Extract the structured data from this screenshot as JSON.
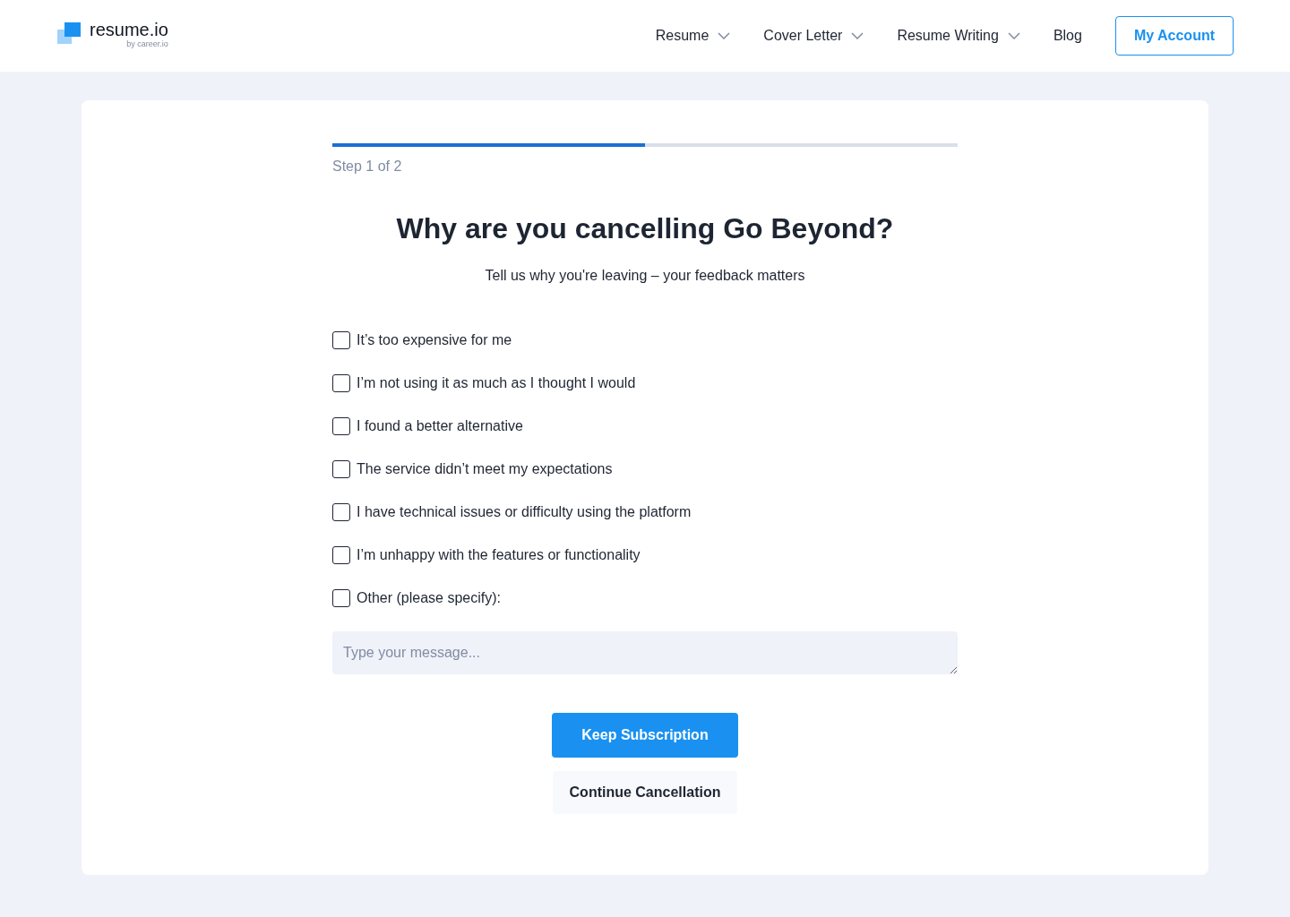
{
  "logo": {
    "name": "resume.io",
    "byline": "by career.io"
  },
  "nav": [
    {
      "label": "Resume",
      "dropdown": true
    },
    {
      "label": "Cover Letter",
      "dropdown": true
    },
    {
      "label": "Resume Writing",
      "dropdown": true
    },
    {
      "label": "Blog",
      "dropdown": false
    }
  ],
  "account_button": "My Account",
  "progress": {
    "level": 0.5,
    "step_label": "Step 1 of 2"
  },
  "title": "Why are you cancelling Go Beyond?",
  "subtitle": "Tell us why you're leaving – your feedback matters",
  "reasons": [
    {
      "label": "It’s too expensive for me",
      "checked": false
    },
    {
      "label": "I’m not using it as much as I thought I would",
      "checked": false
    },
    {
      "label": "I found a better alternative",
      "checked": false
    },
    {
      "label": "The service didn’t meet my expectations",
      "checked": false
    },
    {
      "label": "I have technical issues or difficulty using the platform",
      "checked": false
    },
    {
      "label": "I’m unhappy with the features or functionality",
      "checked": false
    },
    {
      "label": "Other (please specify):",
      "checked": false
    }
  ],
  "message": {
    "placeholder": "Type your message..."
  },
  "buttons": [
    {
      "label": "Keep Subscription",
      "kind": "primary"
    },
    {
      "label": "Continue Cancellation",
      "kind": "secondary"
    }
  ]
}
